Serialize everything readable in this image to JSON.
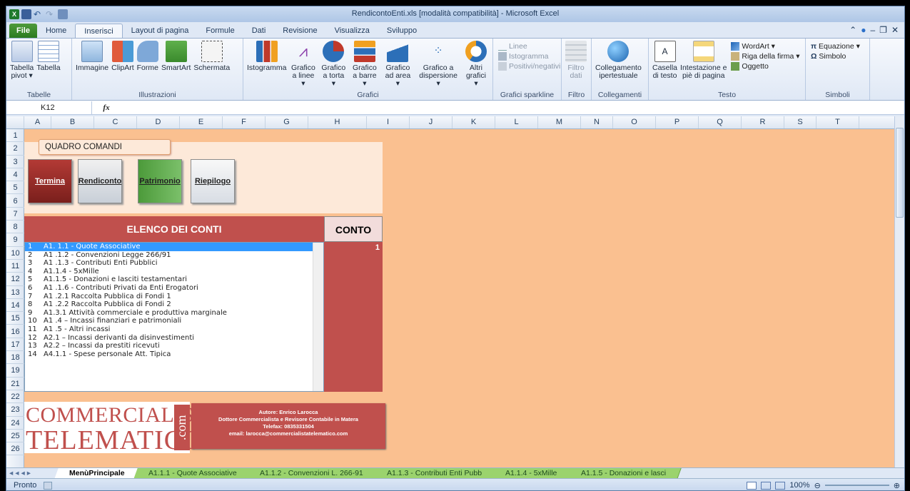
{
  "window": {
    "title": "RendicontoEnti.xls [modalità compatibilità] - Microsoft Excel"
  },
  "tabs": [
    "File",
    "Home",
    "Inserisci",
    "Layout di pagina",
    "Formule",
    "Dati",
    "Revisione",
    "Visualizza",
    "Sviluppo"
  ],
  "ribbon": {
    "tabelle": {
      "label": "Tabelle",
      "items": [
        "Tabella\npivot ▾",
        "Tabella"
      ]
    },
    "illustrazioni": {
      "label": "Illustrazioni",
      "items": [
        "Immagine",
        "ClipArt",
        "Forme",
        "SmartArt",
        "Schermata"
      ]
    },
    "grafici": {
      "label": "Grafici",
      "items": [
        "Istogramma",
        "Grafico\na linee ▾",
        "Grafico\na torta ▾",
        "Grafico\na barre ▾",
        "Grafico\nad area ▾",
        "Grafico a\ndispersione ▾",
        "Altri\ngrafici ▾"
      ]
    },
    "sparkline": {
      "label": "Grafici sparkline",
      "items": [
        "Linee",
        "Istogramma",
        "Positivi/negativi"
      ]
    },
    "filtro": {
      "label": "Filtro",
      "items": [
        "Filtro\ndati"
      ]
    },
    "collegamenti": {
      "label": "Collegamenti",
      "items": [
        "Collegamento\nipertestuale"
      ]
    },
    "testo": {
      "label": "Testo",
      "items": [
        "Casella\ndi testo",
        "Intestazione e\npiè di pagina",
        "WordArt ▾",
        "Riga della firma ▾",
        "Oggetto"
      ]
    },
    "simboli": {
      "label": "Simboli",
      "items": [
        "Equazione ▾",
        "Simbolo"
      ]
    }
  },
  "formula_bar": {
    "name_box": "K12",
    "fx": "fx",
    "value": ""
  },
  "columns": [
    "A",
    "B",
    "C",
    "D",
    "E",
    "F",
    "G",
    "H",
    "I",
    "J",
    "K",
    "L",
    "M",
    "N",
    "O",
    "P",
    "Q",
    "R",
    "S",
    "T"
  ],
  "rows": [
    "1",
    "2",
    "3",
    "4",
    "5",
    "6",
    "7",
    "8",
    "9",
    "10",
    "11",
    "12",
    "13",
    "14",
    "15",
    "16",
    "17",
    "18",
    "19",
    "21",
    "22",
    "23",
    "24",
    "25",
    "26"
  ],
  "sheet": {
    "quadro_label": "QUADRO COMANDI",
    "buttons": [
      "Termina",
      "Rendiconto",
      "Patrimonio",
      "Riepilogo"
    ],
    "elenco_header": "ELENCO DEI CONTI",
    "conto_header": "CONTO",
    "conto_value": "1",
    "list": [
      {
        "n": "1",
        "t": "A1. 1.1 - Quote Associative"
      },
      {
        "n": "2",
        "t": "A1 .1.2 - Convenzioni Legge 266/91"
      },
      {
        "n": "3",
        "t": "A1 .1.3 - Contributi Enti Pubblici"
      },
      {
        "n": "4",
        "t": "A1.1.4 - 5xMille"
      },
      {
        "n": "5",
        "t": "A1.1.5 - Donazioni e lasciti testamentari"
      },
      {
        "n": "6",
        "t": "A1 .1.6 - Contributi Privati da Enti Erogatori"
      },
      {
        "n": "7",
        "t": "A1 .2.1 Raccolta Pubblica di Fondi 1"
      },
      {
        "n": "8",
        "t": "A1 .2.2 Raccolta Pubblica di Fondi 2"
      },
      {
        "n": "9",
        "t": "A1.3.1 Attività commerciale e produttiva marginale"
      },
      {
        "n": "10",
        "t": "A1 .4 – Incassi finanziari e patrimoniali"
      },
      {
        "n": "11",
        "t": "A1 .5 - Altri incassi"
      },
      {
        "n": "12",
        "t": "A2.1 – Incassi derivanti da disinvestimenti"
      },
      {
        "n": "13",
        "t": "A2.2 – Incassi da prestiti ricevuti"
      },
      {
        "n": "14",
        "t": "A4.1.1 - Spese personale Att. Tipica"
      }
    ],
    "logo_line1": "COMMERCIALISTA",
    "logo_line2": "TELEMATICO",
    "logo_com": ".com",
    "author": [
      "Autore: Enrico Larocca",
      "Dottore Commercialista e Revisore Contabile in Matera",
      "Telefax: 0835331504",
      "email: larocca@commercialistatelematico.com"
    ]
  },
  "sheet_tabs": [
    "MenùPrincipale",
    "A1.1.1 - Quote Associative",
    "A1.1.2 - Convenzioni L. 266-91",
    "A1.1.3 - Contributi Enti Pubb",
    "A1.1.4 - 5xMille",
    "A1.1.5 - Donazioni e lasci"
  ],
  "status": {
    "text": "Pronto",
    "zoom": "100%"
  }
}
